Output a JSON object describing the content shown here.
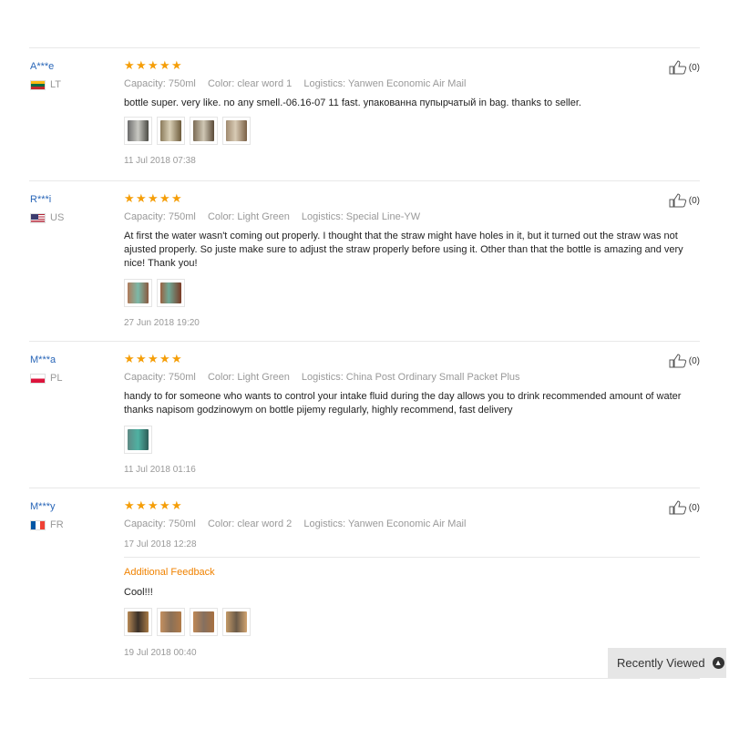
{
  "reviews": [
    {
      "user": "A***e",
      "country": "LT",
      "flag": "lt",
      "capacity": "Capacity: 750ml",
      "color": "Color: clear word 1",
      "logistics": "Logistics: Yanwen Economic Air Mail",
      "text": "bottle super. very like. no any smell.-06.16-07 11 fast. упакованна пупырчатый in bag. thanks to seller.",
      "photos": [
        "photo-bottle-1",
        "photo-bottle-2",
        "photo-bottle-3",
        "photo-bottle-4"
      ],
      "date": "11 Jul 2018 07:38",
      "likes": "(0)",
      "rating": 5
    },
    {
      "user": "R***i",
      "country": "US",
      "flag": "us",
      "capacity": "Capacity: 750ml",
      "color": "Color: Light Green",
      "logistics": "Logistics: Special Line-YW",
      "text": "At first the water wasn't coming out properly. I thought that the straw might have holes in it, but it turned out the straw was not ajusted properly. So juste make sure to adjust the straw properly before using it. Other than that the bottle is amazing and very nice! Thank you!",
      "photos": [
        "photo-bottle-1",
        "photo-bottle-2"
      ],
      "date": "27 Jun 2018 19:20",
      "likes": "(0)",
      "rating": 5
    },
    {
      "user": "M***a",
      "country": "PL",
      "flag": "pl",
      "capacity": "Capacity: 750ml",
      "color": "Color: Light Green",
      "logistics": "Logistics: China Post Ordinary Small Packet Plus",
      "text": "handy to for someone who wants to control your intake fluid during the day allows you to drink recommended amount of water thanks napisom godzinowym on bottle pijemy regularly, highly recommend, fast delivery",
      "photos": [
        "photo-bottle-1"
      ],
      "date": "11 Jul 2018 01:16",
      "likes": "(0)",
      "rating": 5
    },
    {
      "user": "M***y",
      "country": "FR",
      "flag": "fr",
      "capacity": "Capacity: 750ml",
      "color": "Color: clear word 2",
      "logistics": "Logistics: Yanwen Economic Air Mail",
      "date": "17 Jul 2018 12:28",
      "likes": "(0)",
      "rating": 5,
      "additional_label": "Additional Feedback",
      "additional_text": "Cool!!!",
      "additional_photos": [
        "photo-bottle-1",
        "photo-bottle-2",
        "photo-bottle-3",
        "photo-bottle-4"
      ],
      "additional_date": "19 Jul 2018 00:40"
    }
  ],
  "recently_viewed": "Recently Viewed",
  "icons": {
    "star": "star-icon",
    "like": "thumbs-up-icon",
    "chevron": "chevron-up-icon"
  },
  "colors": {
    "star": "#f59e08",
    "username": "#2966b8",
    "additional": "#f08200"
  }
}
